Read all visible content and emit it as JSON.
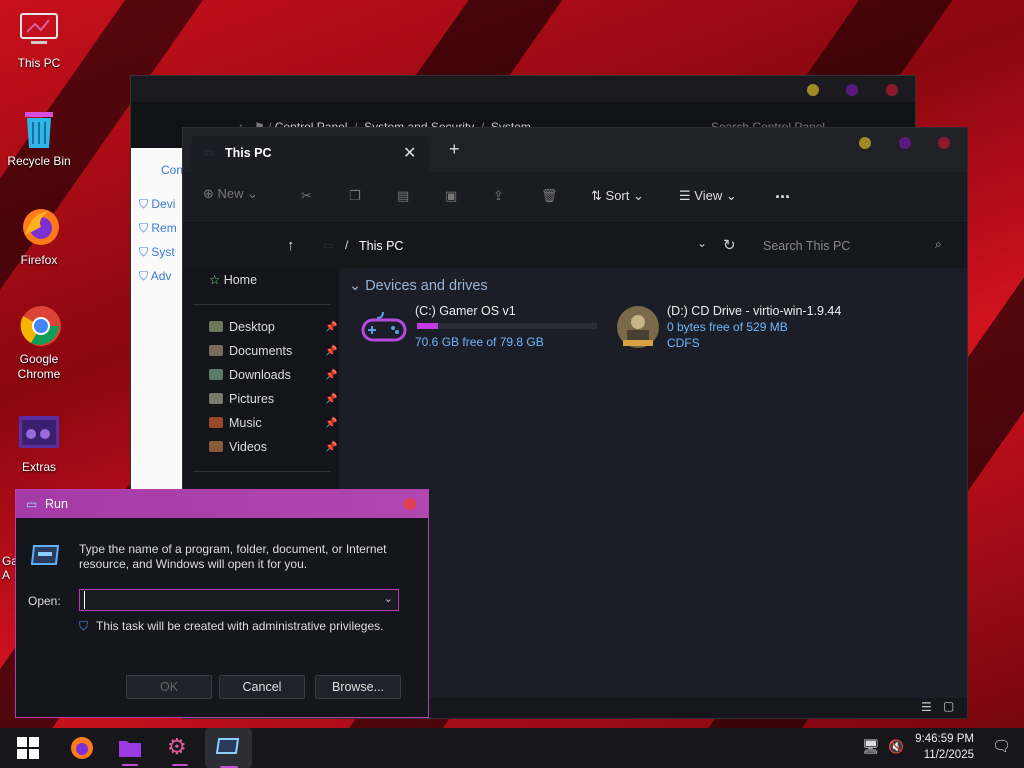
{
  "desktop": {
    "icons": [
      {
        "label": "This PC"
      },
      {
        "label": "Recycle Bin"
      },
      {
        "label": "Firefox"
      },
      {
        "label": "Google Chrome"
      },
      {
        "label": "Extras"
      }
    ],
    "partial_text_1": "Ga",
    "partial_text_2": "A"
  },
  "back_window": {
    "breadcrumb": [
      "Control Panel",
      "System and Security",
      "System"
    ],
    "search_placeholder": "Search Control Panel",
    "side_items": [
      "Con",
      "Devi",
      "Rem",
      "Syst",
      "Adv"
    ]
  },
  "explorer": {
    "tab_title": "This PC",
    "toolbar": {
      "new_label": "New",
      "sort_label": "Sort",
      "view_label": "View",
      "more_label": "..."
    },
    "address": "This PC",
    "search_placeholder": "Search This PC",
    "sidebar": {
      "home": "Home",
      "pinned": [
        "Desktop",
        "Documents",
        "Downloads",
        "Pictures",
        "Music",
        "Videos"
      ]
    },
    "section_title": "Devices and drives",
    "drives": [
      {
        "name": "(C:) Gamer OS v1",
        "info": "70.6 GB free of 79.8 GB",
        "used_fraction": 0.116
      },
      {
        "name": "(D:) CD Drive - virtio-win-1.9.44",
        "info": "0 bytes free of 529 MB",
        "fs": "CDFS"
      }
    ]
  },
  "run_dialog": {
    "title": "Run",
    "description": "Type the name of a program, folder, document, or Internet resource, and Windows will open it for you.",
    "open_label": "Open:",
    "input_value": "",
    "admin_note": "This task will be created with administrative privileges.",
    "ok_label": "OK",
    "cancel_label": "Cancel",
    "browse_label": "Browse..."
  },
  "taskbar": {
    "time": "9:46:59 PM",
    "date": "11/2/2025"
  },
  "colors": {
    "accent": "#c84bd6",
    "drive_info": "#6fb8ff",
    "run_title": "#a43aa7"
  }
}
